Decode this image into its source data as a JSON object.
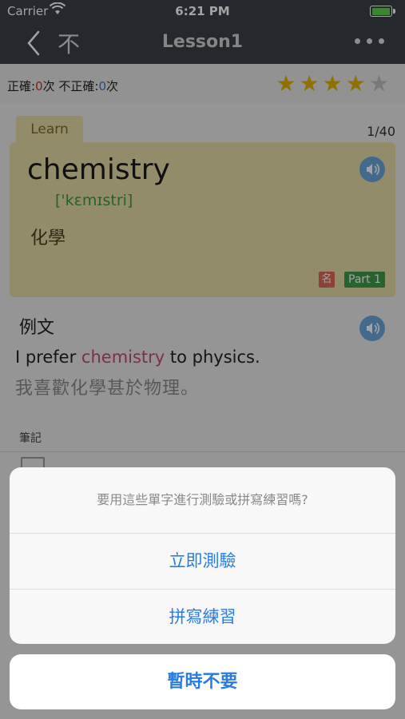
{
  "status_bar": {
    "carrier": "Carrier",
    "time": "6:21 PM"
  },
  "nav": {
    "kanji_icon_char": "不",
    "title": "Lesson1"
  },
  "score": {
    "correct_label": "正確:",
    "correct_count": "0",
    "correct_unit": "次",
    "wrong_label": "不正確:",
    "wrong_count": "0",
    "wrong_unit": "次",
    "stars_filled": 4,
    "stars_total": 5
  },
  "card": {
    "tab_label": "Learn",
    "counter": "1/40",
    "word": "chemistry",
    "phonetic": "['kɛmɪstri]",
    "meaning": "化學",
    "pos_badge": "名",
    "part_badge": "Part 1"
  },
  "example": {
    "title": "例文",
    "en_before": "I prefer ",
    "en_highlight": "chemistry",
    "en_after": " to physics.",
    "zh": "我喜歡化學甚於物理。"
  },
  "notes": {
    "label": "筆記"
  },
  "action_sheet": {
    "message": "要用這些單字進行測驗或拼寫練習嗎?",
    "actions": [
      {
        "label": "立即測驗"
      },
      {
        "label": "拼寫練習"
      }
    ],
    "cancel": "暫時不要"
  },
  "colors": {
    "nav_bg": "#3a3f47",
    "card_bg": "#e6dba6",
    "accent_blue": "#2a7de0",
    "star_gold": "#e2b100",
    "star_gray": "#bdbdbd"
  }
}
